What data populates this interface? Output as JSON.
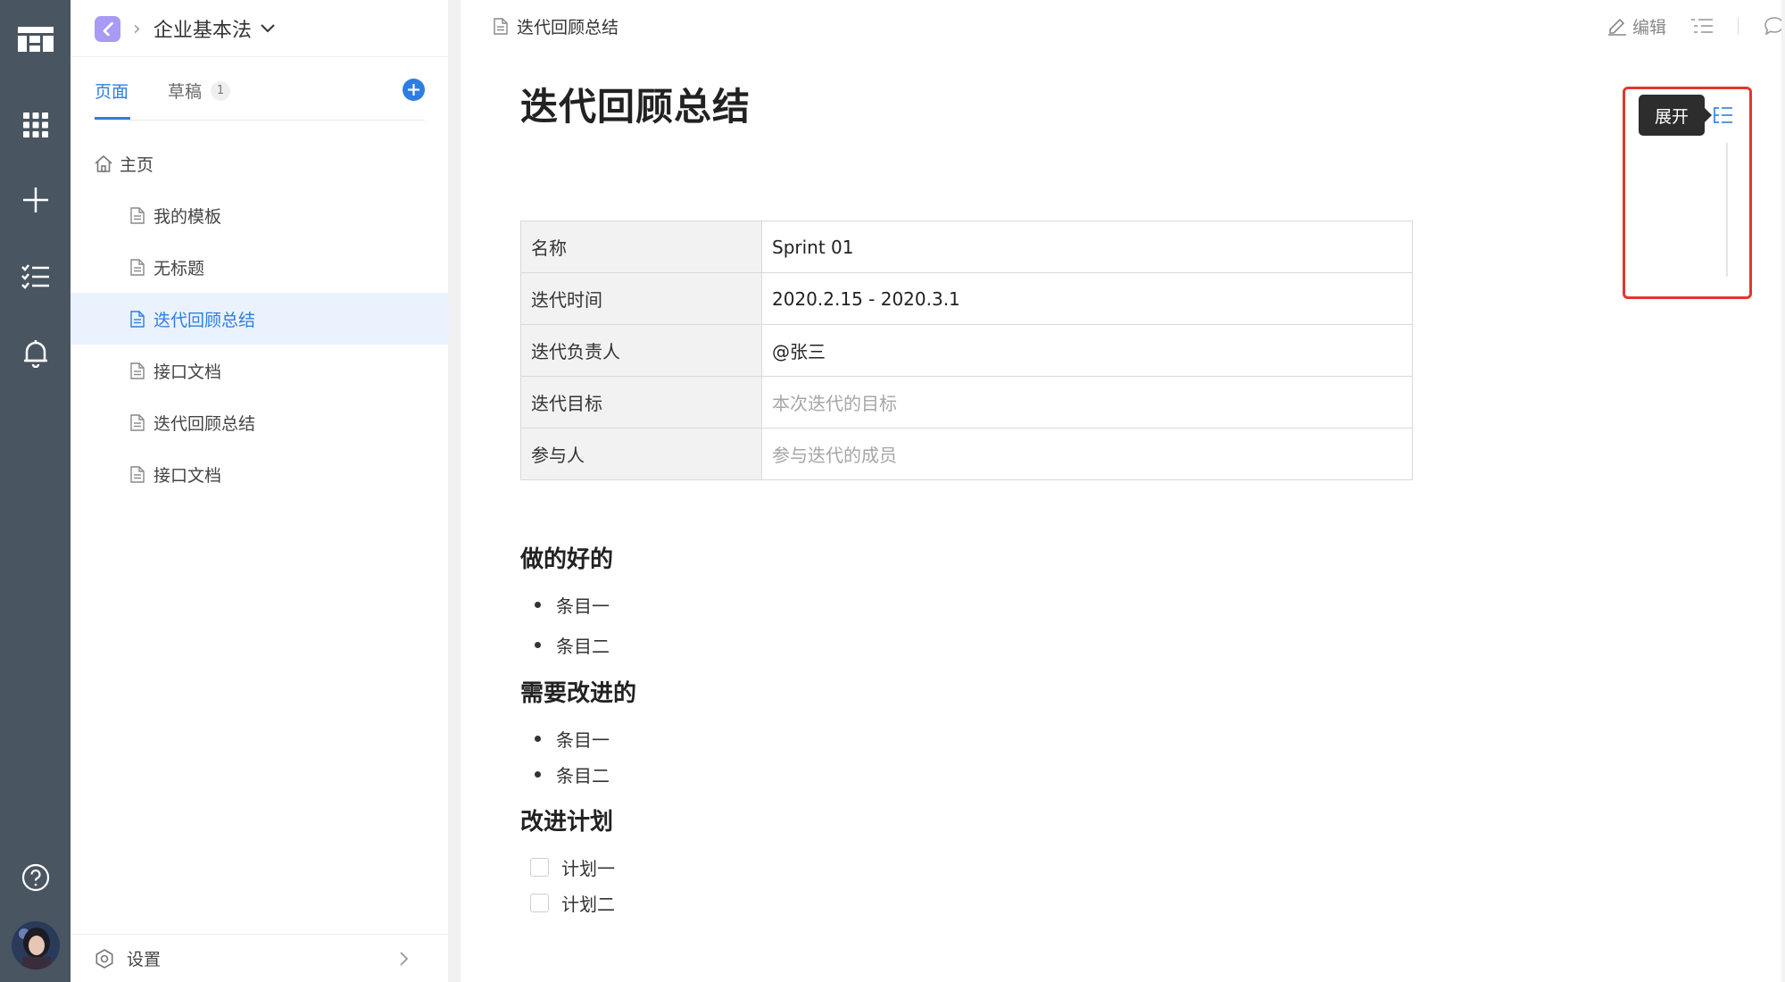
{
  "rail": {
    "items": [
      "logo-icon",
      "apps-icon",
      "add-icon",
      "tasks-icon",
      "bell-icon",
      "help-icon",
      "avatar"
    ]
  },
  "sidebar": {
    "space_name": "企业基本法",
    "tabs": [
      {
        "label": "页面",
        "active": true
      },
      {
        "label": "草稿",
        "count": "1"
      }
    ],
    "tree": [
      {
        "label": "主页",
        "type": "home"
      },
      {
        "label": "我的模板",
        "type": "doc"
      },
      {
        "label": "无标题",
        "type": "doc"
      },
      {
        "label": "迭代回顾总结",
        "type": "doc",
        "active": true
      },
      {
        "label": "接口文档",
        "type": "doc"
      },
      {
        "label": "迭代回顾总结",
        "type": "doc"
      },
      {
        "label": "接口文档",
        "type": "doc"
      }
    ],
    "settings_label": "设置"
  },
  "topbar": {
    "doc_name": "迭代回顾总结",
    "edit_label": "编辑"
  },
  "document": {
    "title": "迭代回顾总结",
    "table": [
      {
        "key": "名称",
        "value": "Sprint 01",
        "placeholder": false
      },
      {
        "key": "迭代时间",
        "value": "2020.2.15 - 2020.3.1",
        "placeholder": false
      },
      {
        "key": "迭代负责人",
        "value": "@张三",
        "placeholder": false
      },
      {
        "key": "迭代目标",
        "value": "本次迭代的目标",
        "placeholder": true
      },
      {
        "key": "参与人",
        "value": "参与迭代的成员",
        "placeholder": true
      }
    ],
    "section_good": {
      "title": "做的好的",
      "items": [
        "条目一",
        "条目二"
      ]
    },
    "section_improve": {
      "title": "需要改进的",
      "items": [
        "条目一",
        "条目二"
      ]
    },
    "section_plan": {
      "title": "改进计划",
      "todos": [
        "计划一",
        "计划二"
      ]
    }
  },
  "outline": {
    "tooltip": "展开"
  },
  "colors": {
    "accent": "#2f7de1",
    "rail": "#4a5562",
    "highlight_box": "#e5362c",
    "active_row": "#e9f2fd"
  }
}
